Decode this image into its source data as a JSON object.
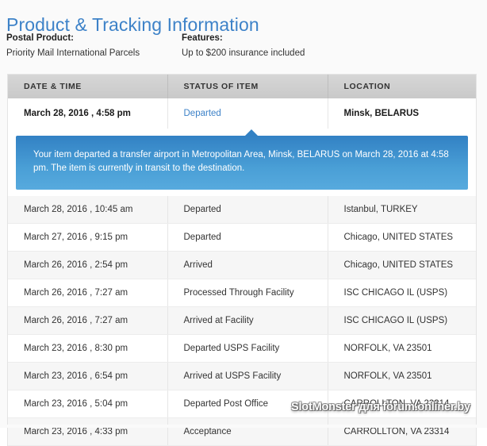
{
  "page": {
    "title": "Product & Tracking Information"
  },
  "summary": {
    "postal_product_label": "Postal Product:",
    "postal_product_value": "Priority Mail International Parcels",
    "features_label": "Features:",
    "features_value": "Up to $200 insurance included"
  },
  "table": {
    "headers": {
      "date": "DATE & TIME",
      "status": "STATUS OF ITEM",
      "location": "LOCATION"
    },
    "current": {
      "date": "March 28, 2016 , 4:58 pm",
      "status": "Departed",
      "location": "Minsk, BELARUS"
    },
    "callout": "Your item departed a transfer airport in Metropolitan Area, Minsk, BELARUS on March 28, 2016 at 4:58 pm. The item is currently in transit to the destination.",
    "rows": [
      {
        "date": "March 28, 2016 , 10:45 am",
        "status": "Departed",
        "location": "Istanbul, TURKEY"
      },
      {
        "date": "March 27, 2016 , 9:15 pm",
        "status": "Departed",
        "location": "Chicago, UNITED STATES"
      },
      {
        "date": "March 26, 2016 , 2:54 pm",
        "status": "Arrived",
        "location": "Chicago, UNITED STATES"
      },
      {
        "date": "March 26, 2016 , 7:27 am",
        "status": "Processed Through Facility",
        "location": "ISC CHICAGO IL (USPS)"
      },
      {
        "date": "March 26, 2016 , 7:27 am",
        "status": "Arrived at Facility",
        "location": "ISC CHICAGO IL (USPS)"
      },
      {
        "date": "March 23, 2016 , 8:30 pm",
        "status": "Departed USPS Facility",
        "location": "NORFOLK, VA 23501"
      },
      {
        "date": "March 23, 2016 , 6:54 pm",
        "status": "Arrived at USPS Facility",
        "location": "NORFOLK, VA 23501"
      },
      {
        "date": "March 23, 2016 , 5:04 pm",
        "status": "Departed Post Office",
        "location": "CARROLLTON, VA 23314"
      },
      {
        "date": "March 23, 2016 , 4:33 pm",
        "status": "Acceptance",
        "location": "CARROLLTON, VA 23314"
      }
    ]
  },
  "watermark": {
    "text": "SlotMonster для forum.onliner.by"
  },
  "colors": {
    "title_blue": "#3d82c8",
    "status_link_blue": "#3d82c8",
    "callout_blue_top": "#3281c4",
    "callout_blue_bottom": "#57aade",
    "header_gray": "#cfcfcf",
    "row_stripe": "#f6f6f6"
  }
}
